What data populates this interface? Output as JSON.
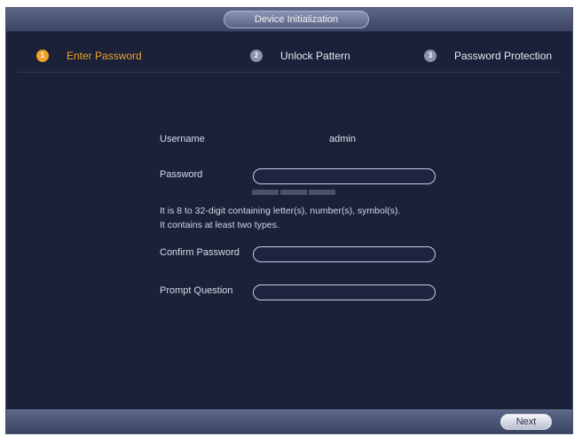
{
  "window": {
    "title": "Device Initialization"
  },
  "steps": [
    {
      "number": "1",
      "label": "Enter Password",
      "active": true
    },
    {
      "number": "2",
      "label": "Unlock Pattern",
      "active": false
    },
    {
      "number": "3",
      "label": "Password Protection",
      "active": false
    }
  ],
  "form": {
    "username_label": "Username",
    "username_value": "admin",
    "password_label": "Password",
    "password_value": "",
    "hint_line_1": "It is 8 to 32-digit containing letter(s), number(s), symbol(s).",
    "hint_line_2": "It contains at least two types.",
    "confirm_label": "Confirm Password",
    "confirm_value": "",
    "prompt_label": "Prompt Question",
    "prompt_value": ""
  },
  "footer": {
    "next_label": "Next"
  },
  "colors": {
    "active_step": "#f0a32a",
    "background": "#1a2138"
  }
}
